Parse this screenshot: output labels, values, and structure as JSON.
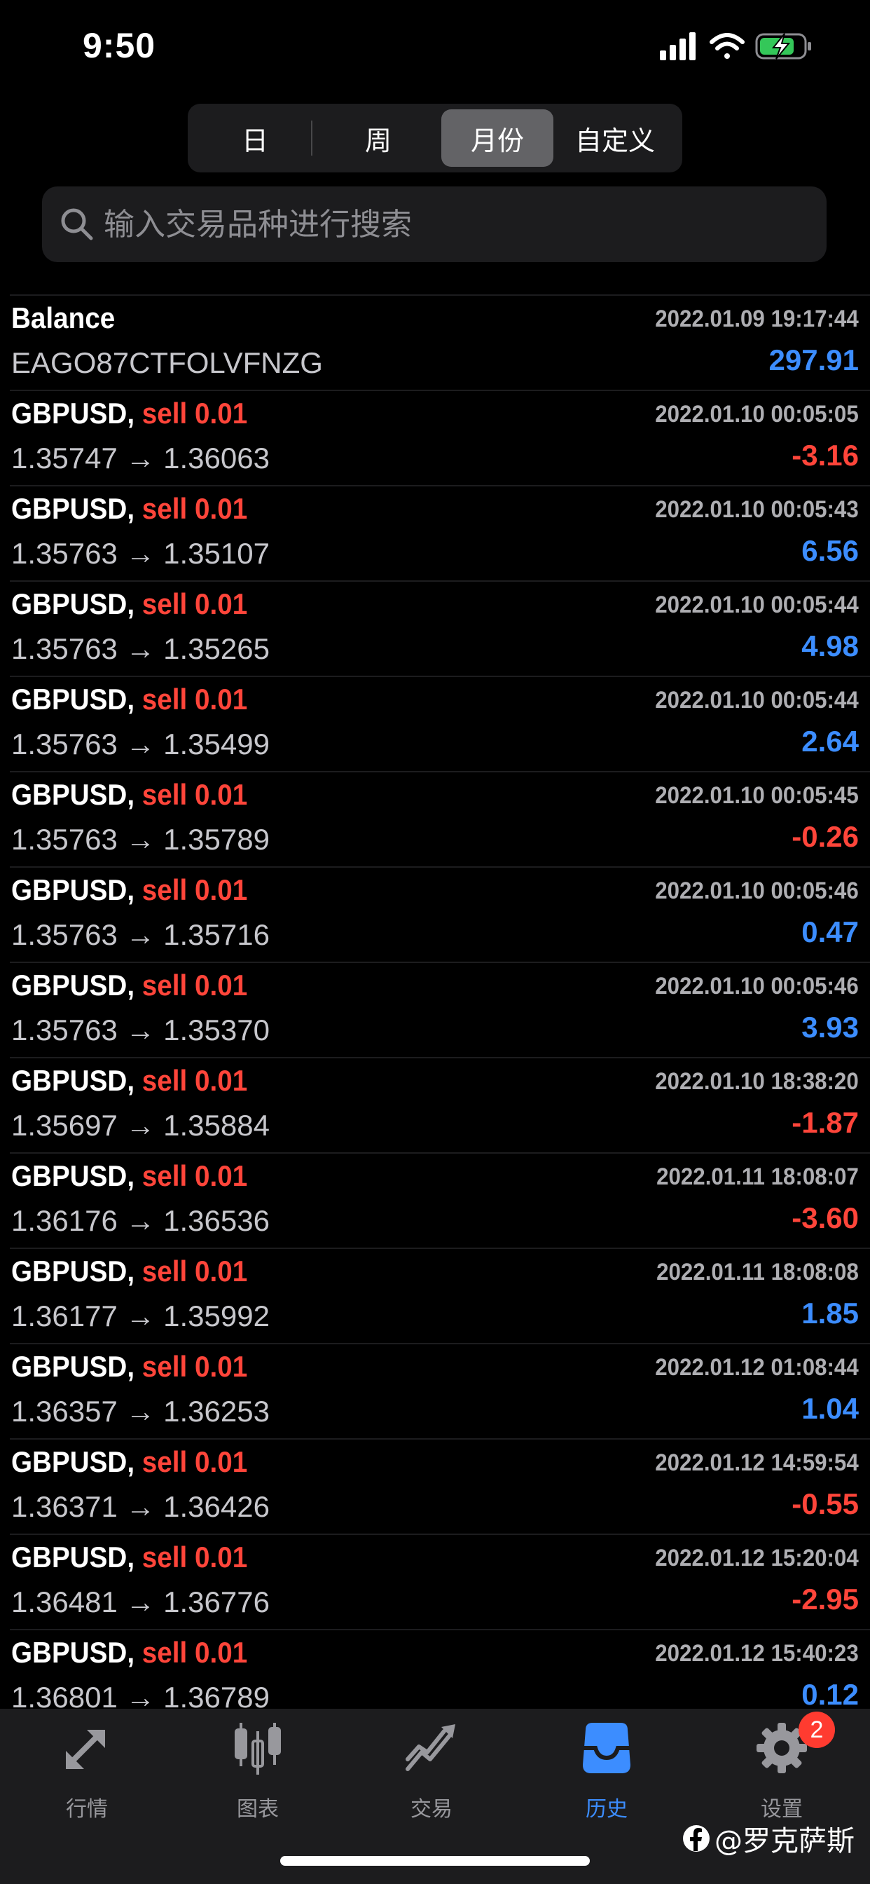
{
  "status_bar": {
    "time": "9:50"
  },
  "segments": [
    {
      "label": "日",
      "active": false
    },
    {
      "label": "周",
      "active": false
    },
    {
      "label": "月份",
      "active": true
    },
    {
      "label": "自定义",
      "active": false
    }
  ],
  "search": {
    "placeholder": "输入交易品种进行搜索"
  },
  "balance": {
    "title": "Balance",
    "datetime": "2022.01.09 19:17:44",
    "id": "EAGO87CTFOLVFNZG",
    "amount": "297.91"
  },
  "deals": [
    {
      "symbol": "GBPUSD",
      "sep": ",",
      "action": "sell 0.01",
      "datetime": "2022.01.10 00:05:05",
      "prices": "1.35747 → 1.36063",
      "profit": "-3.16",
      "sign": "neg"
    },
    {
      "symbol": "GBPUSD",
      "sep": ",",
      "action": "sell 0.01",
      "datetime": "2022.01.10 00:05:43",
      "prices": "1.35763 → 1.35107",
      "profit": "6.56",
      "sign": "pos"
    },
    {
      "symbol": "GBPUSD",
      "sep": ",",
      "action": "sell 0.01",
      "datetime": "2022.01.10 00:05:44",
      "prices": "1.35763 → 1.35265",
      "profit": "4.98",
      "sign": "pos"
    },
    {
      "symbol": "GBPUSD",
      "sep": ",",
      "action": "sell 0.01",
      "datetime": "2022.01.10 00:05:44",
      "prices": "1.35763 → 1.35499",
      "profit": "2.64",
      "sign": "pos"
    },
    {
      "symbol": "GBPUSD",
      "sep": ",",
      "action": "sell 0.01",
      "datetime": "2022.01.10 00:05:45",
      "prices": "1.35763 → 1.35789",
      "profit": "-0.26",
      "sign": "neg"
    },
    {
      "symbol": "GBPUSD",
      "sep": ",",
      "action": "sell 0.01",
      "datetime": "2022.01.10 00:05:46",
      "prices": "1.35763 → 1.35716",
      "profit": "0.47",
      "sign": "pos"
    },
    {
      "symbol": "GBPUSD",
      "sep": ",",
      "action": "sell 0.01",
      "datetime": "2022.01.10 00:05:46",
      "prices": "1.35763 → 1.35370",
      "profit": "3.93",
      "sign": "pos"
    },
    {
      "symbol": "GBPUSD",
      "sep": ",",
      "action": "sell 0.01",
      "datetime": "2022.01.10 18:38:20",
      "prices": "1.35697 → 1.35884",
      "profit": "-1.87",
      "sign": "neg"
    },
    {
      "symbol": "GBPUSD",
      "sep": ",",
      "action": "sell 0.01",
      "datetime": "2022.01.11 18:08:07",
      "prices": "1.36176 → 1.36536",
      "profit": "-3.60",
      "sign": "neg"
    },
    {
      "symbol": "GBPUSD",
      "sep": ",",
      "action": "sell 0.01",
      "datetime": "2022.01.11 18:08:08",
      "prices": "1.36177 → 1.35992",
      "profit": "1.85",
      "sign": "pos"
    },
    {
      "symbol": "GBPUSD",
      "sep": ",",
      "action": "sell 0.01",
      "datetime": "2022.01.12 01:08:44",
      "prices": "1.36357 → 1.36253",
      "profit": "1.04",
      "sign": "pos"
    },
    {
      "symbol": "GBPUSD",
      "sep": ",",
      "action": "sell 0.01",
      "datetime": "2022.01.12 14:59:54",
      "prices": "1.36371 → 1.36426",
      "profit": "-0.55",
      "sign": "neg"
    },
    {
      "symbol": "GBPUSD",
      "sep": ",",
      "action": "sell 0.01",
      "datetime": "2022.01.12 15:20:04",
      "prices": "1.36481 → 1.36776",
      "profit": "-2.95",
      "sign": "neg"
    },
    {
      "symbol": "GBPUSD",
      "sep": ",",
      "action": "sell 0.01",
      "datetime": "2022.01.12 15:40:23",
      "prices": "1.36801 → 1.36789",
      "profit": "0.12",
      "sign": "pos"
    }
  ],
  "tabs": [
    {
      "label": "行情",
      "icon": "quotes-arrows-icon",
      "active": false
    },
    {
      "label": "图表",
      "icon": "candlestick-chart-icon",
      "active": false
    },
    {
      "label": "交易",
      "icon": "trade-chart-icon",
      "active": false
    },
    {
      "label": "历史",
      "icon": "history-inbox-icon",
      "active": true
    },
    {
      "label": "设置",
      "icon": "gear-icon",
      "active": false
    }
  ],
  "settings_badge": "2",
  "watermark": {
    "text": "@罗克萨斯",
    "icon": "facebook-icon"
  },
  "colors": {
    "positive": "#3c8dff",
    "negative": "#ff453a",
    "tab_active": "#3c8dff"
  }
}
